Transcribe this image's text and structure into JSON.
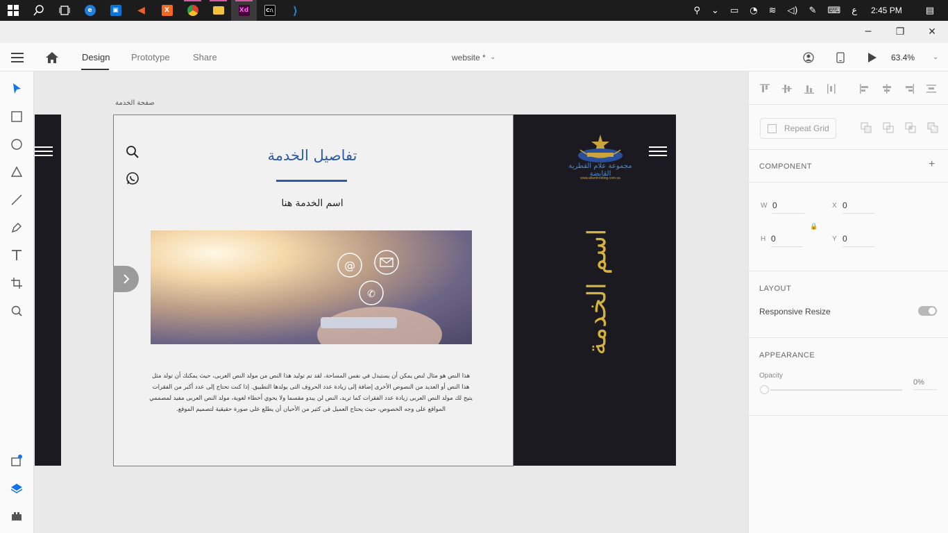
{
  "taskbar": {
    "apps": [
      {
        "name": "start-icon"
      },
      {
        "name": "search-icon"
      },
      {
        "name": "task-view-icon"
      },
      {
        "name": "edge-icon",
        "color": "#1f7de0",
        "glyph": "e"
      },
      {
        "name": "store-icon",
        "color": "#0a74d6",
        "glyph": "🛍"
      },
      {
        "name": "media-icon",
        "color": "#e8612c",
        "glyph": "◀"
      },
      {
        "name": "xampp-icon",
        "color": "#f26a22",
        "glyph": "X"
      },
      {
        "name": "chrome-icon",
        "color": "#e33b2e",
        "glyph": "◉"
      },
      {
        "name": "file-explorer-icon",
        "color": "#f0c33c",
        "glyph": "▬"
      },
      {
        "name": "adobe-xd-icon",
        "color": "#470137",
        "glyph": "Xd"
      },
      {
        "name": "terminal-icon",
        "color": "#333333",
        "glyph": "C:\\"
      },
      {
        "name": "vscode-icon",
        "color": "#1f8ad2",
        "glyph": "⟩"
      }
    ],
    "lang_indicator": "ع",
    "time": "2:45 PM"
  },
  "app": {
    "tabs": {
      "design": "Design",
      "prototype": "Prototype",
      "share": "Share"
    },
    "document_title": "website *",
    "zoom": "63.4%"
  },
  "artboard": {
    "label": "صفحة الخدمة",
    "title": "تفاصيل الخدمة",
    "subtitle": "اسم الخدمة هنا",
    "body": "هذا النص هو مثال لنص يمكن أن يستبدل في نفس المساحة، لقد تم توليد هذا النص من مولد النص العربى، حيث يمكنك أن تولد مثل هذا النص أو العديد من النصوص الأخرى إضافة إلى زيادة عدد الحروف التى يولدها التطبيق. إذا كنت تحتاج إلى عدد أكبر من الفقرات يتيح لك مولد النص العربى زيادة عدد الفقرات كما تريد، النص لن يبدو مقسما ولا يحوي أخطاء لغوية، مولد النص العربى مفيد لمصممي المواقع على وجه الخصوص، حيث يحتاج العميل فى كثير من الأحيان أن يطلع على صورة حقيقية لتصميم الموقع.",
    "vertical_title": "اسم الخدمة",
    "logo_text": "مجموعة علام القطرية القابضة",
    "logo_url": "www.allamholding.com.sa"
  },
  "panel": {
    "repeat_grid": "Repeat Grid",
    "component_heading": "COMPONENT",
    "w_label": "W",
    "w_value": "0",
    "x_label": "X",
    "x_value": "0",
    "h_label": "H",
    "h_value": "0",
    "y_label": "Y",
    "y_value": "0",
    "layout_heading": "LAYOUT",
    "responsive_resize": "Responsive Resize",
    "responsive_resize_on": true,
    "appearance_heading": "APPEARANCE",
    "opacity_label": "Opacity",
    "opacity_value": "0%"
  },
  "colors": {
    "accent_blue": "#2c5aa8",
    "gold": "#d5b13f",
    "dark_panel": "#1b1a20",
    "selection": "#3a8fd1"
  }
}
